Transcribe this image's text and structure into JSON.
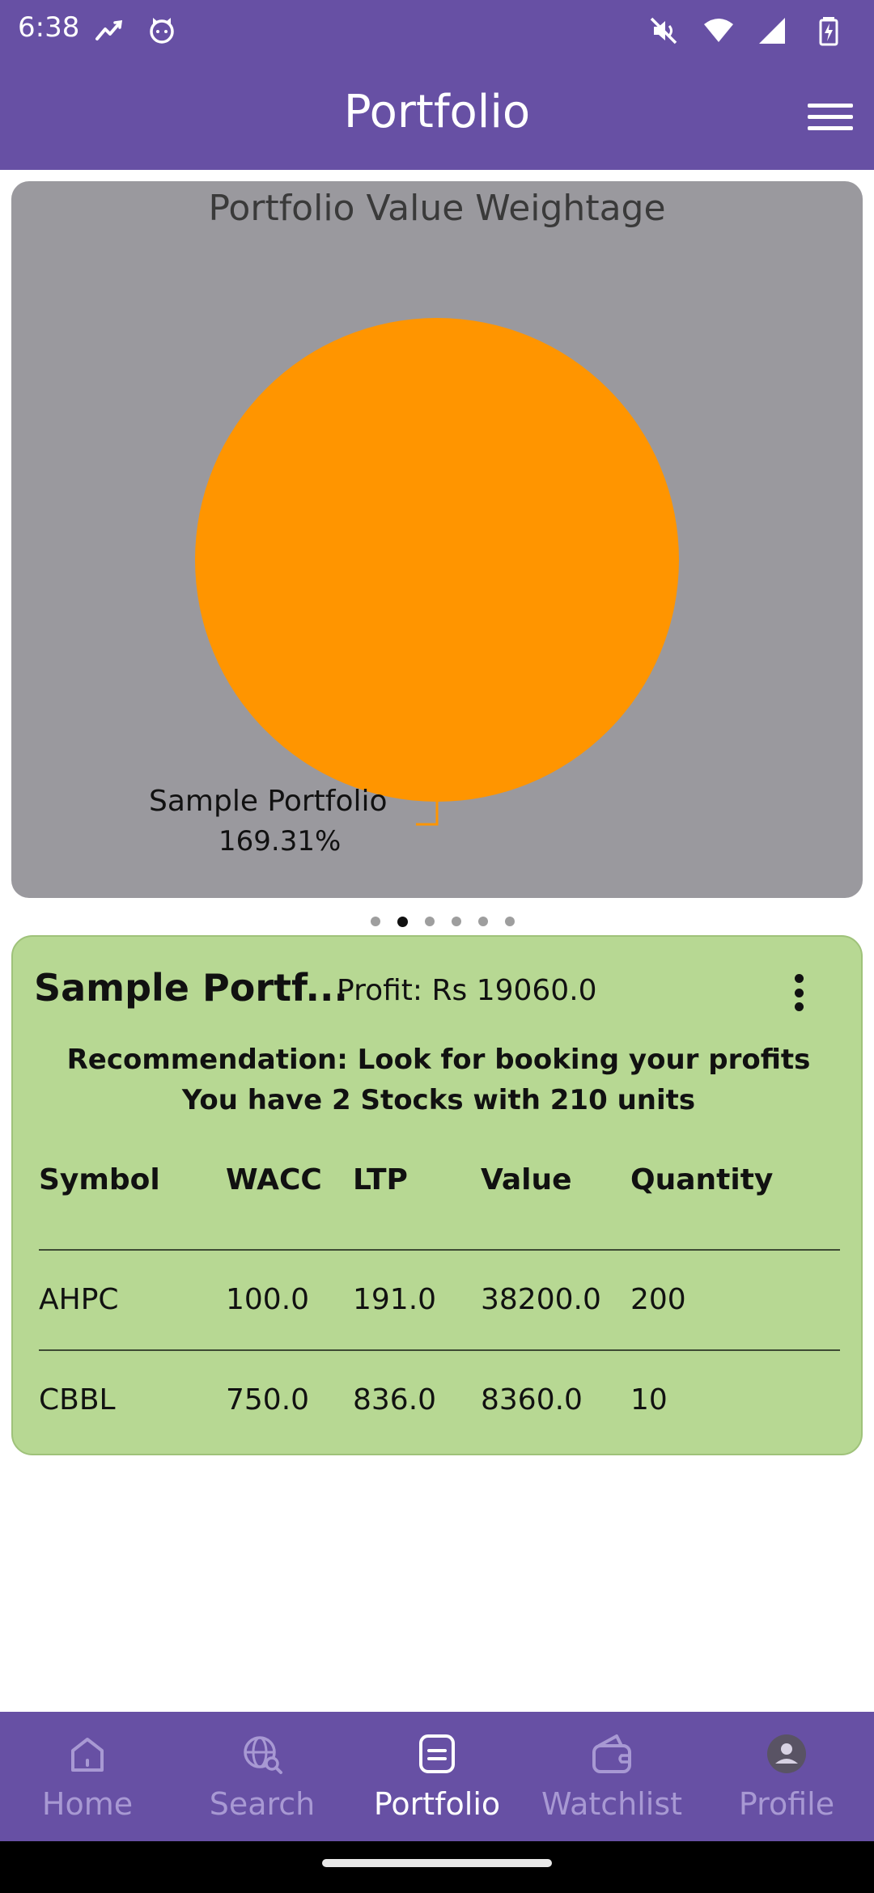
{
  "status_bar": {
    "time": "6:38",
    "left_icons": [
      "stocks-app-icon",
      "cat-app-icon"
    ],
    "right_icons": [
      "mute-icon",
      "wifi-icon",
      "signal-icon",
      "battery-icon"
    ]
  },
  "app_bar": {
    "title": "Portfolio",
    "menu_icon": "hamburger-menu-icon"
  },
  "chart": {
    "title": "Portfolio Value Weightage",
    "slice_color": "#ff9500",
    "background_color": "#9a999e"
  },
  "chart_data": {
    "type": "pie",
    "title": "Portfolio Value Weightage",
    "slices": [
      {
        "label": "Sample Portfolio",
        "value": 100,
        "display_value": "169.31%"
      }
    ]
  },
  "pager": {
    "count": 6,
    "active_index": 1
  },
  "portfolio_card": {
    "name": "Sample Portf...",
    "profit": "Profit: Rs 19060.0",
    "recommendation": "Recommendation:  Look for booking your profits",
    "summary": "You have 2 Stocks with 210 units",
    "columns": [
      "Symbol",
      "WACC",
      "LTP",
      "Value",
      "Quantity"
    ],
    "rows": [
      [
        "AHPC",
        "100.0",
        "191.0",
        "38200.0",
        "200"
      ],
      [
        "CBBL",
        "750.0",
        "836.0",
        "8360.0",
        "10"
      ]
    ],
    "card_color": "#b7d893"
  },
  "bottom_nav": {
    "items": [
      {
        "label": "Home",
        "icon": "home-icon"
      },
      {
        "label": "Search",
        "icon": "globe-search-icon"
      },
      {
        "label": "Portfolio",
        "icon": "portfolio-icon"
      },
      {
        "label": "Watchlist",
        "icon": "wallet-icon"
      },
      {
        "label": "Profile",
        "icon": "profile-icon"
      }
    ],
    "active_index": 2,
    "accent": "#6750a4"
  }
}
